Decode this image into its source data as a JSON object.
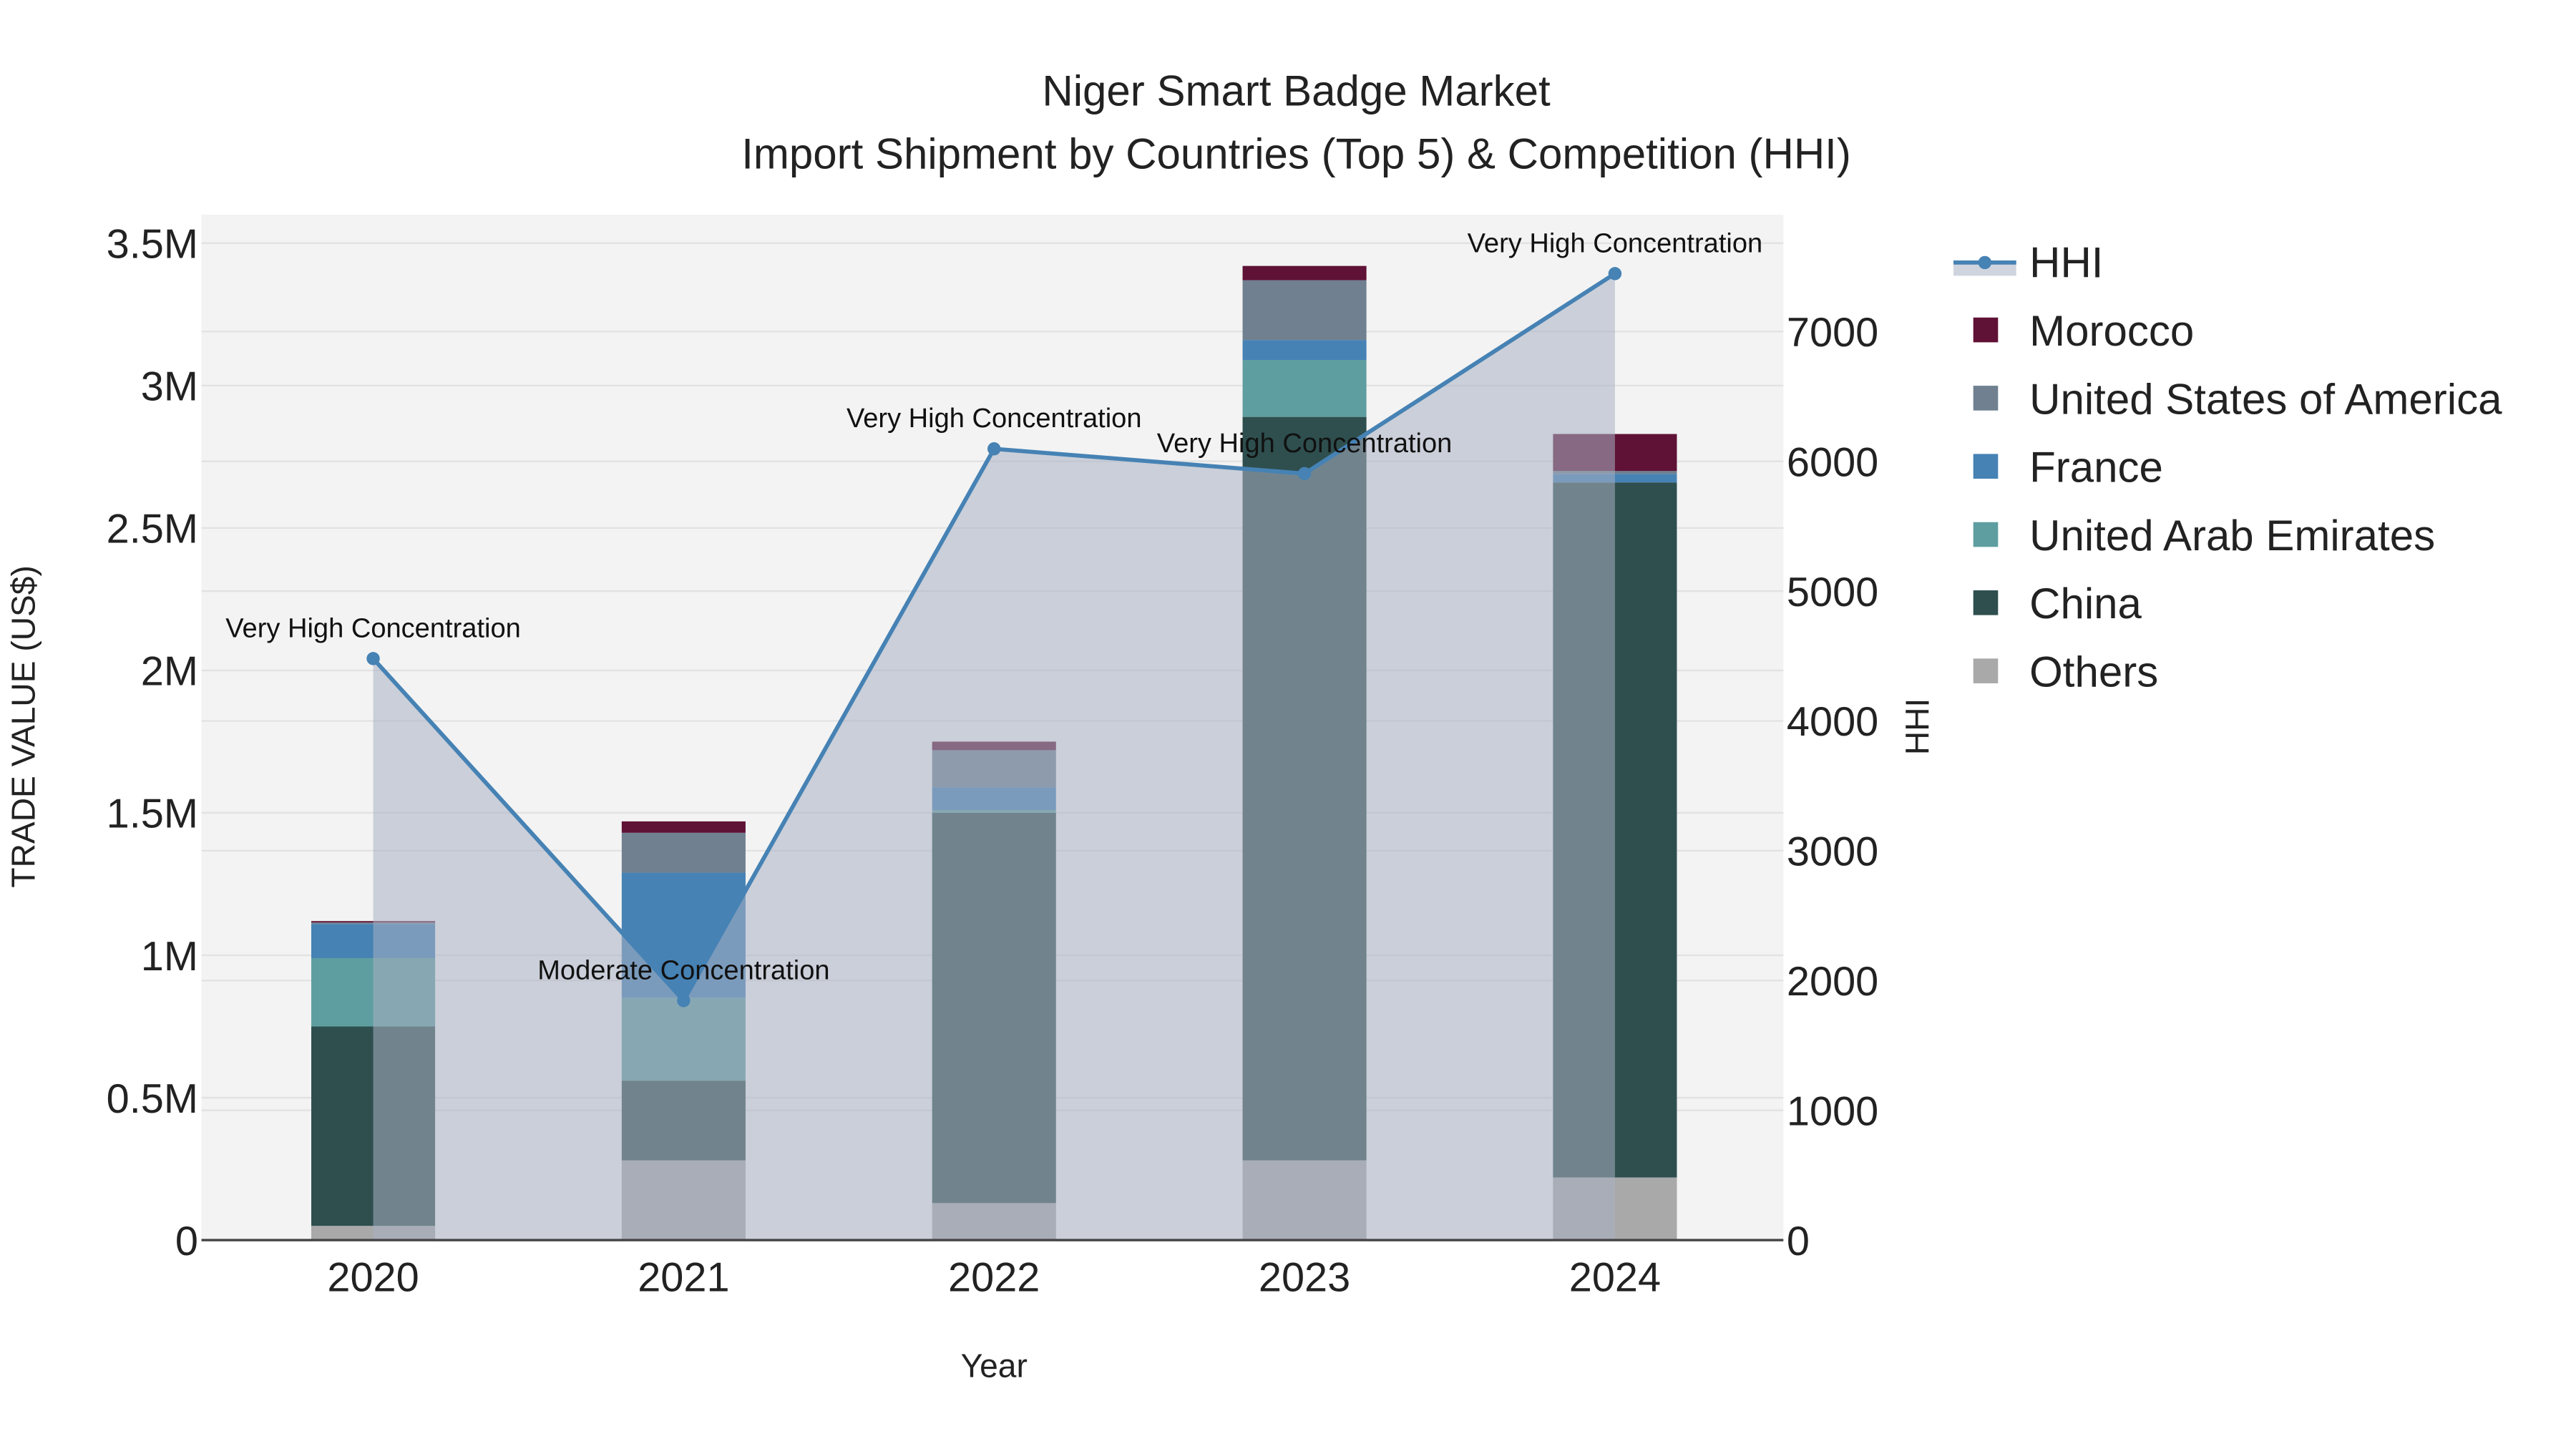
{
  "chart_data": {
    "type": "bar",
    "stacked": true,
    "title": "Niger Smart Badge Market",
    "subtitle": "Import Shipment by Countries (Top 5) & Competition (HHI)",
    "xlabel": "Year",
    "ylabel": "TRADE VALUE (US$)",
    "y2label": "HHI",
    "categories": [
      "2020",
      "2021",
      "2022",
      "2023",
      "2024"
    ],
    "ylim": [
      0,
      3600000
    ],
    "y2lim": [
      0,
      7900
    ],
    "yticks": [
      {
        "value": 0,
        "label": "0"
      },
      {
        "value": 500000,
        "label": "0.5M"
      },
      {
        "value": 1000000,
        "label": "1M"
      },
      {
        "value": 1500000,
        "label": "1.5M"
      },
      {
        "value": 2000000,
        "label": "2M"
      },
      {
        "value": 2500000,
        "label": "2.5M"
      },
      {
        "value": 3000000,
        "label": "3M"
      },
      {
        "value": 3500000,
        "label": "3.5M"
      }
    ],
    "y2ticks": [
      {
        "value": 0,
        "label": "0"
      },
      {
        "value": 1000,
        "label": "1000"
      },
      {
        "value": 2000,
        "label": "2000"
      },
      {
        "value": 3000,
        "label": "3000"
      },
      {
        "value": 4000,
        "label": "4000"
      },
      {
        "value": 5000,
        "label": "5000"
      },
      {
        "value": 6000,
        "label": "6000"
      },
      {
        "value": 7000,
        "label": "7000"
      }
    ],
    "series": [
      {
        "name": "Others",
        "color": "#a9a9a9",
        "values": [
          50000,
          280000,
          130000,
          280000,
          220000
        ]
      },
      {
        "name": "China",
        "color": "#2f4f4f",
        "values": [
          700000,
          280000,
          1370000,
          2610000,
          2440000
        ]
      },
      {
        "name": "United Arab Emirates",
        "color": "#5f9ea0",
        "values": [
          240000,
          290000,
          10000,
          200000,
          0
        ]
      },
      {
        "name": "France",
        "color": "#4682b4",
        "values": [
          120000,
          440000,
          80000,
          70000,
          30000
        ]
      },
      {
        "name": "United States of America",
        "color": "#708090",
        "values": [
          5000,
          140000,
          130000,
          210000,
          10000
        ]
      },
      {
        "name": "Morocco",
        "color": "#5f1235",
        "values": [
          5000,
          40000,
          30000,
          50000,
          130000
        ]
      }
    ],
    "hhi": {
      "name": "HHI",
      "color": "#4682b4",
      "values": [
        4480,
        1845,
        6096,
        5905,
        7446
      ],
      "annotations": [
        "Very High Concentration",
        "Moderate Concentration",
        "Very High Concentration",
        "Very High Concentration",
        "Very High Concentration"
      ]
    },
    "legend": {
      "placement": "right",
      "items": [
        "HHI",
        "Morocco",
        "United States of America",
        "France",
        "United Arab Emirates",
        "China",
        "Others"
      ]
    },
    "grid": true
  }
}
